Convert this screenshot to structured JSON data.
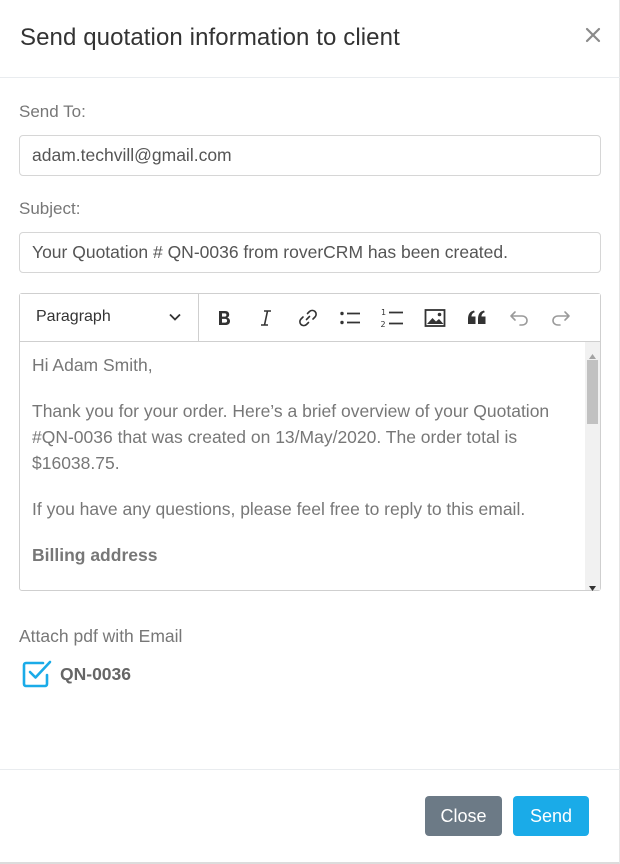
{
  "modal": {
    "title": "Send quotation information to client"
  },
  "form": {
    "send_to_label": "Send To:",
    "send_to_value": "adam.techvill@gmail.com",
    "subject_label": "Subject:",
    "subject_value": "Your Quotation # QN-0036 from roverCRM has been created."
  },
  "editor": {
    "paragraph_select": "Paragraph",
    "toolbar_icons": [
      "bold-icon",
      "italic-icon",
      "link-icon",
      "bulleted-list-icon",
      "numbered-list-icon",
      "image-icon",
      "blockquote-icon",
      "undo-icon",
      "redo-icon"
    ],
    "content": {
      "greeting": "Hi Adam Smith,",
      "body1": "Thank you for your order. Here’s a brief overview of your Quotation #QN-0036 that was created on 13/May/2020. The order total is $16038.75.",
      "body2": "If you have any questions, please feel free to reply to this email.",
      "billing_heading": "Billing address"
    }
  },
  "attachment": {
    "label": "Attach pdf with Email",
    "file_name": "QN-0036",
    "checked": true
  },
  "footer": {
    "close_label": "Close",
    "send_label": "Send"
  },
  "colors": {
    "accent": "#1aabe8",
    "close_button": "#6c7a86",
    "checkbox": "#1aabe8"
  }
}
